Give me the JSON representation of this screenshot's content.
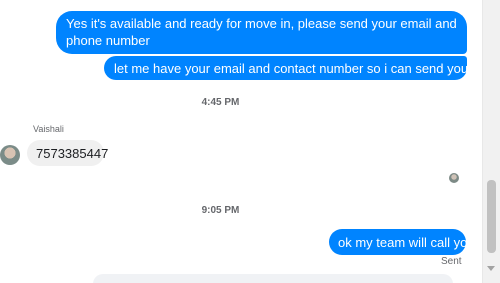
{
  "messages": [
    {
      "text": "Yes it's available and ready for move in, please send your email and phone number",
      "direction": "outgoing"
    },
    {
      "text": "let me have your email and contact number so i can send you details",
      "direction": "outgoing"
    },
    {
      "text": "7573385447",
      "direction": "incoming",
      "sender": "Vaishali"
    },
    {
      "text": "ok my team will call you",
      "direction": "outgoing"
    }
  ],
  "timestamps": [
    "4:45 PM",
    "9:05 PM"
  ],
  "sender_name": "Vaishali",
  "status": "Sent",
  "colors": {
    "outgoing_bubble": "#0084ff",
    "incoming_bubble": "#f0f0f0",
    "meta_text": "#65676b"
  },
  "icons": [
    "avatar",
    "read-receipt-avatar",
    "scroll-down-arrow-icon"
  ]
}
